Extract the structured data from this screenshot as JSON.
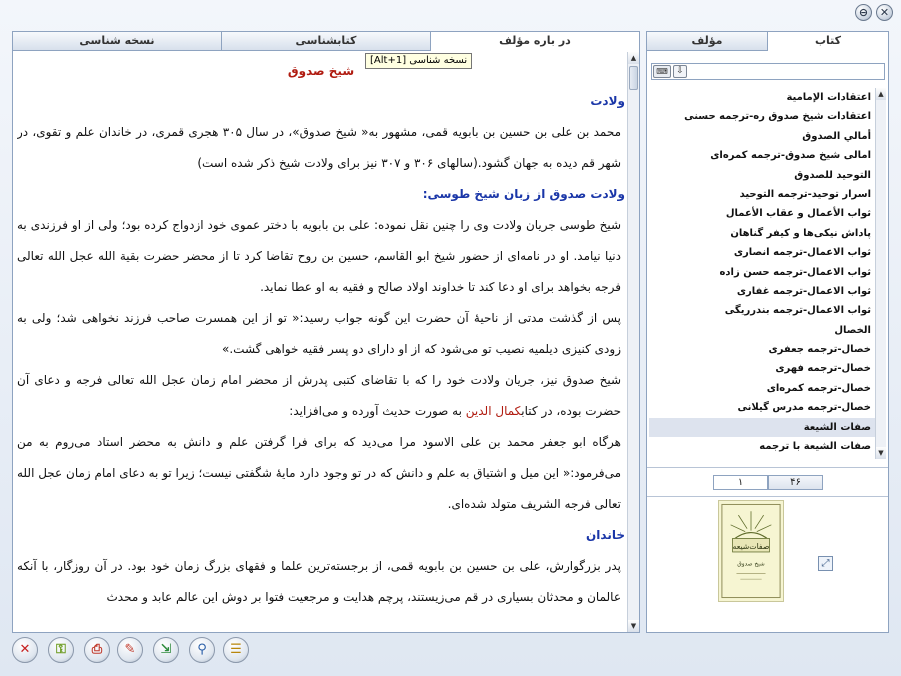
{
  "window": {
    "minimize_glyph": "⊖",
    "close_glyph": "✕"
  },
  "doc_tabs": [
    {
      "label": "نسخه شناسی"
    },
    {
      "label": "کتابشناسی"
    },
    {
      "label": "در باره مؤلف",
      "active": true
    }
  ],
  "tooltip": "نسخه شناسی [Alt+1]",
  "document": {
    "title": "شیخ صدوق",
    "sections": [
      {
        "heading": "ولادت",
        "paragraphs": [
          "محمد بن علی بن حسین بن بابویه قمی، مشهور به« شیخ صدوق»، در سال ۳۰۵ هجری قمری، در خاندان علم و تقوی، در شهر قم دیده به جهان گشود.(سالهای ۳۰۶ و ۳۰۷ نیز برای ولادت شیخ ذکر شده است)"
        ]
      },
      {
        "heading": "ولادت صدوق از زبان شیخ طوسی:",
        "paragraphs": [
          "شیخ طوسی جریان ولادت وی را چنین نقل نموده: علی بن بابویه با دختر عموی خود ازدواج کرده بود؛ ولی از او فرزندی به دنیا نیامد. او در نامه‌ای از حضور شیخ ابو القاسم، حسین بن روح تقاضا کرد تا از محضر حضرت بقیة الله عجل الله تعالی فرجه بخواهد برای او دعا کند تا خداوند اولاد صالح و فقیه به او عطا نماید.",
          "پس از گذشت مدتی از ناحیهٔ آن حضرت این گونه جواب رسید:« تو از این همسرت صاحب فرزند نخواهی شد؛ ولی به زودی کنیزی دیلمیه نصیب تو می‌شود که از او دارای دو پسر فقیه خواهی گشت.»"
        ]
      },
      {
        "heading": "",
        "paragraphs": [
          "شیخ صدوق نیز، جریان ولادت خود را که با تقاضای کتبی پدرش از محضر امام زمان عجل الله تعالی فرجه و دعای آن حضرت بوده، در کتاب",
          "کمال الدین",
          " به صورت حدیث آورده و می‌افزاید:",
          "هرگاه ابو جعفر محمد بن علی الاسود مرا می‌دید که برای فرا گرفتن علم و دانش به محضر استاد می‌روم به من می‌فرمود:« این میل و اشتیاق به علم و دانش که در تو وجود دارد مایهٔ شگفتی نیست؛ زیرا تو به دعای امام زمان عجل الله تعالی فرجه الشریف متولد شده‌ای."
        ]
      },
      {
        "heading": "خاندان",
        "paragraphs": [
          "پدر بزرگوارش، علی بن حسین بن بابویه قمی، از برجسته‌ترین علما و فقهای بزرگ زمان خود بود. در آن روزگار، با آنکه عالمان و محدثان بسیاری در قم می‌زیستند، پرچم هدایت و مرجعیت فتوا بر دوش این عالم عابد و محدث"
        ]
      }
    ]
  },
  "book_tabs": [
    {
      "label": "مؤلف"
    },
    {
      "label": "کتاب",
      "active": true
    }
  ],
  "search": {
    "placeholder": "",
    "kbd_glyph": "⌨",
    "down_glyph": "⇩"
  },
  "books": [
    "اعتقادات الإمامیة",
    "اعتقادات شیخ صدوق ره-ترجمه حسنی",
    "أمالي الصدوق",
    "امالی شیخ صدوق-ترجمه کمره‌ای",
    "التوحید للصدوق",
    "اسرار توحید-ترجمه التوحید",
    "ثواب الأعمال و عقاب الأعمال",
    "پاداش نیکی‌ها و کیفر گناهان",
    "ثواب الاعمال-ترجمه انصاری",
    "ثواب الاعمال-ترجمه حسن زاده",
    "ثواب الاعمال-ترجمه غفاری",
    "ثواب الاعمال-ترجمه بندرریگی",
    "الخصال",
    "خصال-ترجمه جعفری",
    "خصال-ترجمه فهری",
    "خصال-ترجمه کمره‌ای",
    "خصال-ترجمه مدرس گیلانی",
    "صفات الشیعة",
    "صفات الشیعة با ترجمه"
  ],
  "selected_book_index": 17,
  "pager": {
    "total": "۴۶",
    "current": "۱"
  },
  "cover": {
    "title": "صفات‌شیعه",
    "subtitle": "شیخ صدوق"
  },
  "toolbar": [
    {
      "name": "exit-button",
      "glyph": "✕",
      "color": "#c62020"
    },
    {
      "name": "key-button",
      "glyph": "⚿",
      "color": "#6a9a1e"
    },
    {
      "name": "print-button",
      "glyph": "⎙",
      "color": "#c0392b"
    },
    {
      "name": "edit-button",
      "glyph": "✎",
      "color": "#c0392b"
    },
    {
      "name": "export-button",
      "glyph": "⇲",
      "color": "#2e8b3d"
    },
    {
      "name": "search-button",
      "glyph": "⚲",
      "color": "#2b5fa8"
    },
    {
      "name": "notes-button",
      "glyph": "☰",
      "color": "#b8860b"
    }
  ],
  "colors": {
    "accent_heading": "#1a36a8",
    "accent_title": "#b01b10",
    "border": "#8ea3c0"
  }
}
